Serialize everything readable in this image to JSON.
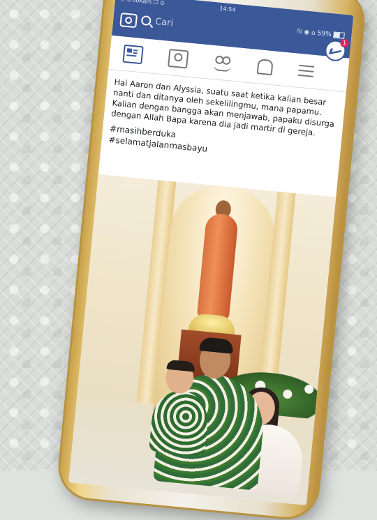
{
  "status": {
    "left": "(( 0.00KB/s ☐ ⊙",
    "time": "14:54",
    "right": "ℕ ◉ ⌂ 59%"
  },
  "search": {
    "placeholder": "Cari"
  },
  "messenger": {
    "badge": "1"
  },
  "post": {
    "body": "Hai Aaron dan Alyssia, suatu saat ketika kalian besar nanti dan ditanya oleh sekelilingmu, mana papamu. Kalian dengan bangga akan menjawab, papaku disurga dengan Allah Bapa karena dia jadi martir di gereja.",
    "hashtags": [
      "#masihberduka",
      "#selamatjalanmasbayu"
    ]
  },
  "colors": {
    "facebook_blue": "#3b5998",
    "phone_gold": "#c9a24a"
  },
  "icons": [
    "camera-icon",
    "search-icon",
    "news-feed-icon",
    "profile-icon",
    "friends-icon",
    "bell-icon",
    "menu-icon",
    "messenger-icon"
  ]
}
